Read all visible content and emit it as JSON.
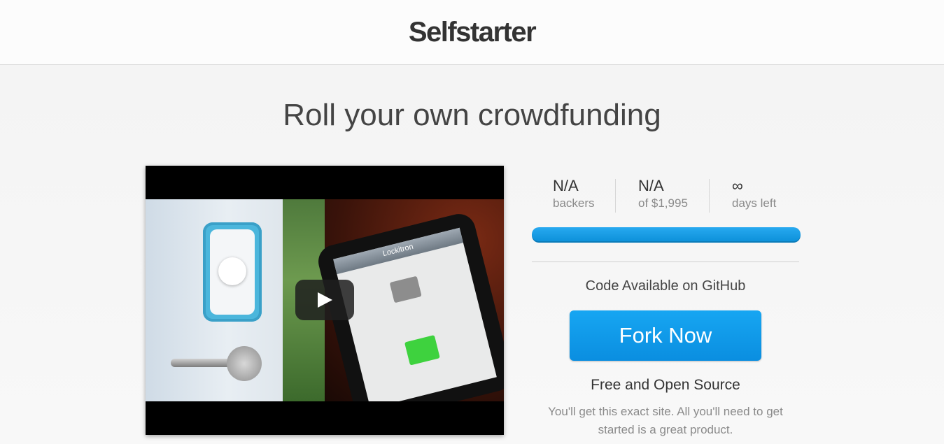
{
  "header": {
    "logo": "Selfstarter"
  },
  "hero": {
    "headline": "Roll your own crowdfunding"
  },
  "video": {
    "phone_title": "Lockitron",
    "play_icon": "play-icon"
  },
  "stats": {
    "backers_value": "N/A",
    "backers_label": "backers",
    "raised_value": "N/A",
    "raised_label": "of $1,995",
    "days_value": "∞",
    "days_label": "days left"
  },
  "progress": {
    "percent": 100,
    "color": "#0b8fd8"
  },
  "cta": {
    "github_text": "Code Available on GitHub",
    "fork_button": "Fork Now",
    "oss_title": "Free and Open Source",
    "oss_desc": "You'll get this exact site. All you'll need to get started is a great product."
  }
}
